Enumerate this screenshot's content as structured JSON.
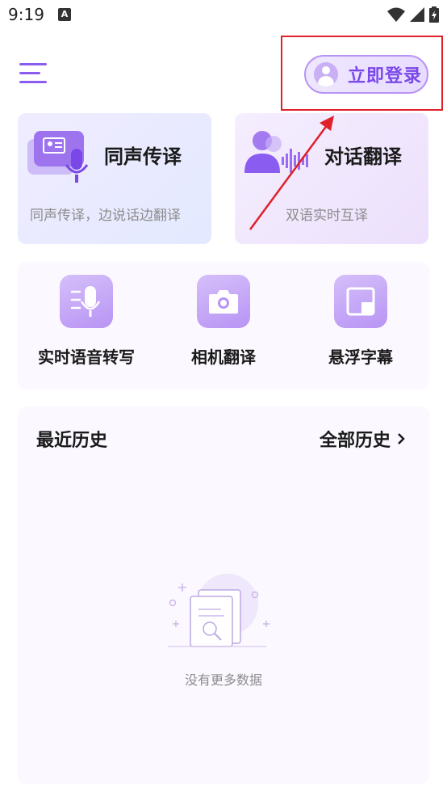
{
  "status_bar": {
    "time": "9:19",
    "notification_badge": "A"
  },
  "header": {
    "login_label": "立即登录"
  },
  "feature_cards": [
    {
      "title": "同声传译",
      "subtitle": "同声传译，边说话边翻译"
    },
    {
      "title": "对话翻译",
      "subtitle": "双语实时互译"
    }
  ],
  "tools": [
    {
      "label": "实时语音转写",
      "icon": "mic-list-icon"
    },
    {
      "label": "相机翻译",
      "icon": "camera-icon"
    },
    {
      "label": "悬浮字幕",
      "icon": "floating-window-icon"
    }
  ],
  "history": {
    "title": "最近历史",
    "all_label": "全部历史",
    "empty_text": "没有更多数据"
  },
  "colors": {
    "accent": "#8a5cf0",
    "annotation": "#e0202a"
  }
}
